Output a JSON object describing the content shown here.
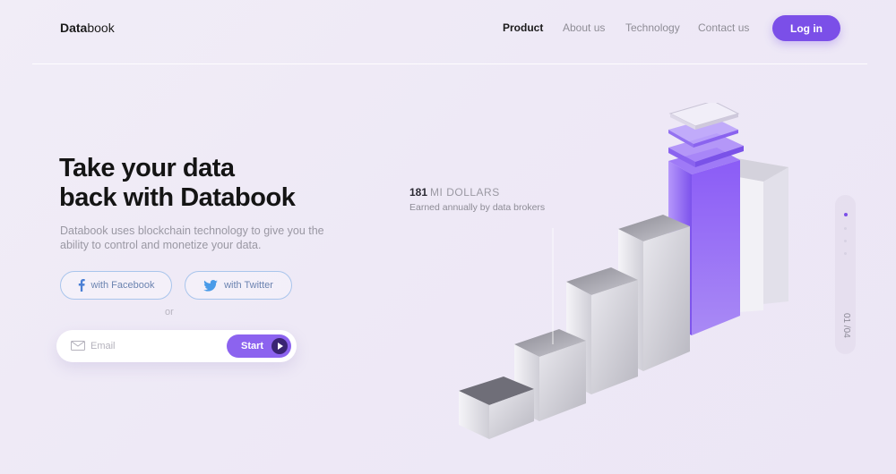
{
  "brand": {
    "logo_bold": "Data",
    "logo_rest": "book"
  },
  "nav": {
    "items": [
      {
        "label": "Product",
        "active": true
      },
      {
        "label": "About us",
        "active": false
      },
      {
        "label": "Technology",
        "active": false
      },
      {
        "label": "Contact us",
        "active": false
      }
    ],
    "login_label": "Log in"
  },
  "hero": {
    "headline_line1": "Take your data",
    "headline_line2": "back with Databook",
    "description": "Databook uses blockchain technology to give you the ability to control and monetize your data.",
    "facebook_label": "with Facebook",
    "twitter_label": "with Twitter",
    "or_label": "or",
    "email_placeholder": "Email",
    "start_label": "Start"
  },
  "stat": {
    "number": "181",
    "unit": "MI DOLLARS",
    "subtitle": "Earned annually by data brokers"
  },
  "pager": {
    "label": "01 /04",
    "current": 1,
    "total": 4
  },
  "icons": {
    "facebook": "facebook-icon",
    "twitter": "twitter-icon",
    "email": "mail-icon",
    "start": "play-icon"
  },
  "colors": {
    "accent": "#7b4fe8",
    "accent_light": "#8c63ef",
    "social_border": "#a9c5ec",
    "facebook_blue": "#4a7fd4",
    "twitter_blue": "#4a9be8"
  }
}
